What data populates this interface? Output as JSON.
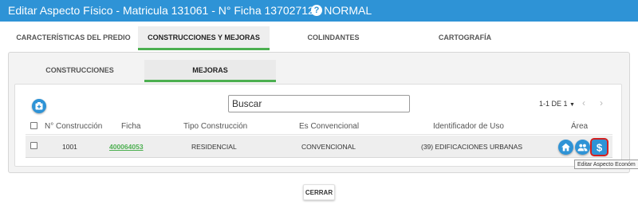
{
  "dialog": {
    "title": "Editar Aspecto Físico - Matricula 131061 - N° Ficha 13702712 - NORMAL",
    "help_icon": "question-circle-icon"
  },
  "main_tabs": [
    {
      "label": "CARACTERÍSTICAS DEL PREDIO",
      "active": false
    },
    {
      "label": "CONSTRUCCIONES Y MEJORAS",
      "active": true
    },
    {
      "label": "COLINDANTES",
      "active": false
    },
    {
      "label": "CARTOGRAFÍA",
      "active": false
    }
  ],
  "sub_tabs": [
    {
      "label": "CONSTRUCCIONES",
      "active": false
    },
    {
      "label": "MEJORAS",
      "active": true
    }
  ],
  "toolbar": {
    "add_icon": "add-box-icon",
    "search_placeholder": "Buscar",
    "pagination": "1-1 DE 1",
    "prev_icon": "chevron-left-icon",
    "next_icon": "chevron-right-icon"
  },
  "table": {
    "headers": [
      "N° Construcción",
      "Ficha",
      "Tipo Construcción",
      "Es Convencional",
      "Identificador de Uso",
      "Área"
    ],
    "rows": [
      {
        "numero": "1001",
        "ficha": "400064053",
        "tipo": "RESIDENCIAL",
        "convencional": "CONVENCIONAL",
        "uso": "(39) EDIFICACIONES URBANAS",
        "actions": [
          "home-icon",
          "people-icon",
          "dollar-icon"
        ]
      }
    ]
  },
  "tooltip": "Editar Aspecto Económ",
  "footer": {
    "close_label": "CERRAR"
  },
  "colors": {
    "primary": "#2e93d6",
    "accent": "#4caf50",
    "highlight": "#d32020"
  }
}
